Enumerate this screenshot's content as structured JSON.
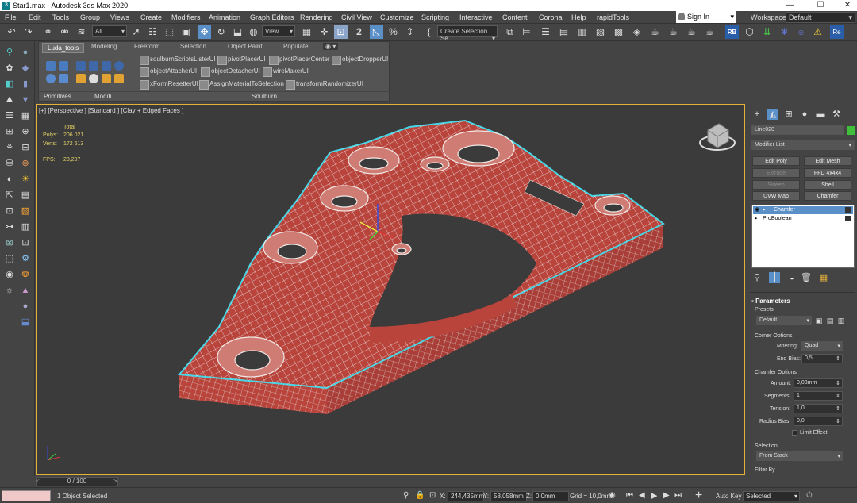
{
  "window": {
    "title": "Star1.max - Autodesk 3ds Max 2020",
    "minimize": "—",
    "maximize": "☐",
    "close": "✕",
    "app_icon": "3"
  },
  "menu": [
    "File",
    "Edit",
    "Tools",
    "Group",
    "Views",
    "Create",
    "Modifiers",
    "Animation",
    "Graph Editors",
    "Rendering",
    "Civil View",
    "Customize",
    "Scripting",
    "Interactive",
    "Content",
    "Corona",
    "Help",
    "rapidTools"
  ],
  "signin": "Sign In",
  "workspaces": {
    "label": "Workspaces:",
    "value": "Default"
  },
  "toolbar": {
    "filter": "All",
    "view": "View",
    "selection_set": "Create Selection Se",
    "rb": "RB",
    "re": "Re"
  },
  "ribbon": {
    "tabs": [
      "Luda_tools",
      "Modeling",
      "Freeform",
      "Selection",
      "Object Paint",
      "Populate"
    ],
    "group_labels": [
      "Primitives",
      "Modifi",
      "Soulburn"
    ],
    "scripts": [
      "soulburnScriptsListerUI",
      "pivotPlacerUI",
      "pivotPlacerCenter",
      "objectDropperUI",
      "objectAttacherUI",
      "objectDetacherUI",
      "wireMakerUI",
      "xFormResetterUI",
      "AssignMaterialToSelection",
      "transformRandomizerUI"
    ]
  },
  "viewport": {
    "label": "[+] [Perspective ] [Standard ] [Clay + Edged Faces ]",
    "stats": {
      "total": "Total",
      "polys_label": "Polys:",
      "polys": "206 021",
      "verts_label": "Verts:",
      "verts": "172 613",
      "fps_label": "FPS:",
      "fps": "23,297"
    }
  },
  "command_panel": {
    "object_name": "Line020",
    "object_color": "#3fbf3a",
    "modifier_list": "Modifier List",
    "buttons": [
      {
        "label": "Edit Poly",
        "enabled": true
      },
      {
        "label": "Edit Mesh",
        "enabled": true
      },
      {
        "label": "Extrude",
        "enabled": false
      },
      {
        "label": "FFD 4x4x4",
        "enabled": true
      },
      {
        "label": "Sweep",
        "enabled": false
      },
      {
        "label": "Shell",
        "enabled": true
      },
      {
        "label": "UVW Map",
        "enabled": true
      },
      {
        "label": "Chamfer",
        "enabled": true
      }
    ],
    "stack": [
      {
        "label": "Chamfer",
        "selected": true
      },
      {
        "label": "ProBoolean",
        "selected": false
      }
    ],
    "parameters": {
      "title": "Parameters",
      "presets_label": "Presets",
      "presets": "Default",
      "corner_options": "Corner Options",
      "mitering_label": "Mitering:",
      "mitering": "Quad",
      "end_bias_label": "End Bias:",
      "end_bias": "0,5",
      "chamfer_options": "Chamfer Options",
      "amount_label": "Amount:",
      "amount": "0,03mm",
      "segments_label": "Segments:",
      "segments": "1",
      "tension_label": "Tension:",
      "tension": "1,0",
      "radius_bias_label": "Radius Bias:",
      "radius_bias": "0,0",
      "limit_effect": "Limit Effect",
      "selection": "Selection",
      "from_stack": "From Stack",
      "filter_by": "Filter By"
    }
  },
  "timeline": {
    "frame": "0 / 100",
    "prev": "<",
    "next": ">"
  },
  "status": {
    "objects": "1 Object Selected",
    "x_label": "X:",
    "x": "244,435mm",
    "y_label": "Y:",
    "y": "58,058mm",
    "z_label": "Z:",
    "z": "0,0mm",
    "grid": "Grid = 10,0mm",
    "auto_key": "Auto Key",
    "selected": "Selected",
    "plus": "+"
  },
  "colors": {
    "mesh": "#b8443c",
    "wire": "#f1e8e5",
    "outline": "#45d6e6",
    "viewport_border": "#e5b13b",
    "accent": "#5b8fc7"
  }
}
